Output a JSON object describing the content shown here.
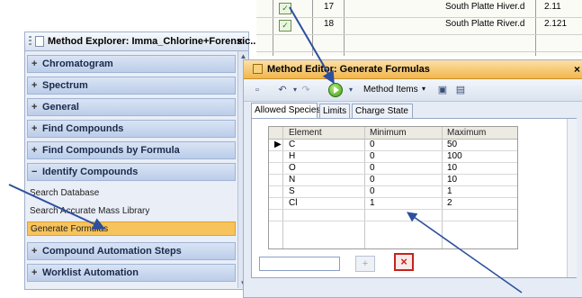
{
  "background_table": {
    "rows": [
      {
        "check": "✓",
        "num": "17",
        "file": "South Platte Hiver.d",
        "value": "2.11"
      },
      {
        "check": "✓",
        "num": "18",
        "file": "South Platte River.d",
        "value": "2.121"
      }
    ]
  },
  "explorer": {
    "title": "Method Explorer: Imma_Chlorine+Forensic..",
    "close": "×",
    "sections": [
      {
        "sign": "+",
        "label": "Chromatogram"
      },
      {
        "sign": "+",
        "label": "Spectrum"
      },
      {
        "sign": "+",
        "label": "General"
      },
      {
        "sign": "+",
        "label": "Find Compounds"
      },
      {
        "sign": "+",
        "label": "Find Compounds by Formula"
      },
      {
        "sign": "−",
        "label": "Identify Compounds"
      },
      {
        "sign": "+",
        "label": "Compound Automation Steps"
      },
      {
        "sign": "+",
        "label": "Worklist Automation"
      }
    ],
    "sub_items": [
      {
        "label": "Search Database",
        "selected": false
      },
      {
        "label": "Search Accurate Mass Library",
        "selected": false
      },
      {
        "label": "Generate Formulas",
        "selected": true
      }
    ]
  },
  "editor": {
    "title": "Method Editor: Generate Formulas",
    "close": "×",
    "toolbar": {
      "method_items_label": "Method Items",
      "icons": [
        "window-icon",
        "undo-icon",
        "redo-icon",
        "run-icon",
        "dropdown-icon",
        "save-icon",
        "report-icon"
      ]
    },
    "tabs": [
      "Allowed Species",
      "Limits",
      "Charge State"
    ],
    "active_tab": 0,
    "grid": {
      "headers": [
        "Element",
        "Minimum",
        "Maximum"
      ],
      "rows": [
        {
          "element": "C",
          "min": "0",
          "max": "50",
          "current": true
        },
        {
          "element": "H",
          "min": "0",
          "max": "100",
          "current": false
        },
        {
          "element": "O",
          "min": "0",
          "max": "10",
          "current": false
        },
        {
          "element": "N",
          "min": "0",
          "max": "10",
          "current": false
        },
        {
          "element": "S",
          "min": "0",
          "max": "1",
          "current": false
        },
        {
          "element": "Cl",
          "min": "1",
          "max": "2",
          "current": false
        }
      ]
    },
    "input_value": "",
    "add_button_symbol": "+",
    "delete_button_symbol": "×"
  },
  "colors": {
    "selection_orange": "#f6c35c",
    "explorer_section": "#c8d6ef",
    "editor_title": "#f2b64c",
    "annotation_arrow": "#2d4f9e",
    "delete_red": "#c5231c"
  }
}
